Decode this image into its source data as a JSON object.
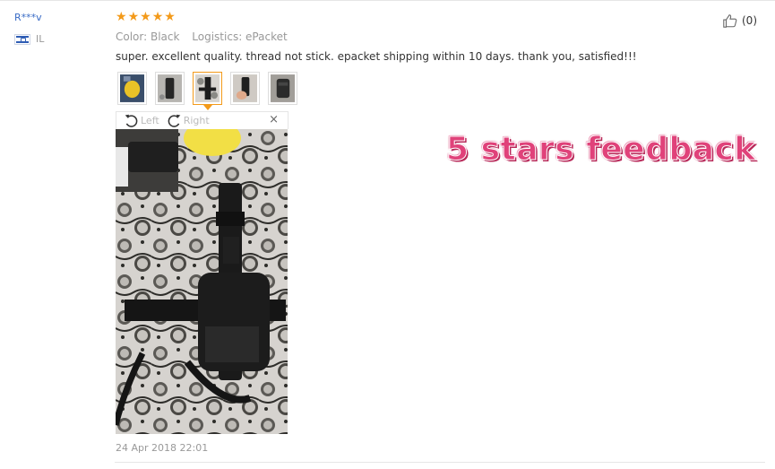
{
  "reviewer": {
    "name": "R***v",
    "country": "IL"
  },
  "rating": {
    "stars": 5,
    "max": 5
  },
  "review": {
    "color_label": "Color: Black",
    "logistics_label": "Logistics: ePacket",
    "text": "super. excellent quality. thread not stick. epacket shipping within 10 days. thank you, satisfied!!!",
    "date": "24 Apr 2018 22:01"
  },
  "helpful": {
    "count": "(0)"
  },
  "viewer": {
    "left_label": "Left",
    "right_label": "Right",
    "close_label": "×",
    "active_thumb": 3
  },
  "thumbnails": [
    "yellow-bag",
    "holster-gray",
    "holster-on-floral",
    "holster-in-hand",
    "holster-pouch"
  ],
  "overlay": {
    "caption": "5 stars feedback"
  },
  "colors": {
    "accent": "#f39a1a",
    "link": "#3a6cc6",
    "caption": "#e0427a"
  },
  "icons": {
    "helpful": "thumbs-up-icon",
    "rotate_left": "rotate-left-icon",
    "rotate_right": "rotate-right-icon",
    "close": "close-icon"
  }
}
